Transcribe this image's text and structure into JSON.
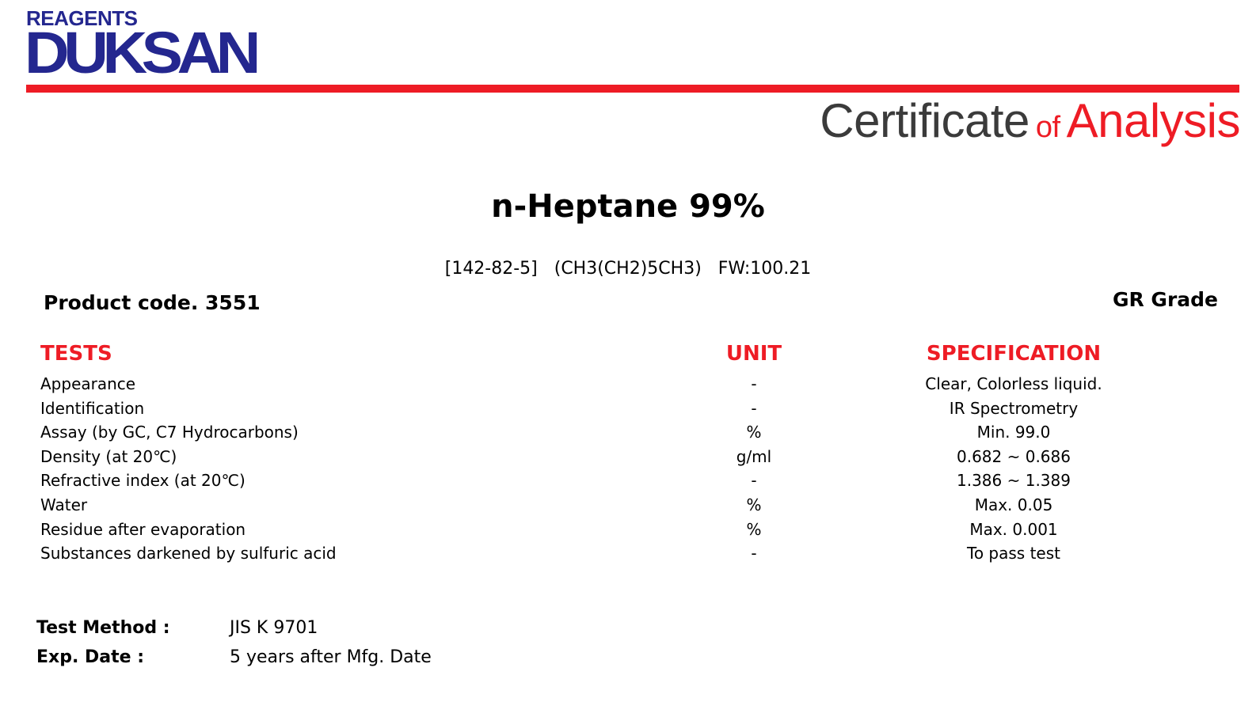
{
  "logo": {
    "top": "REAGENTS",
    "main": "DUKSAN"
  },
  "title": {
    "part1": "Certificate",
    "part2": "of",
    "part3": "Analysis"
  },
  "product": {
    "name": "n-Heptane 99%",
    "formula_line": "[142-82-5]   (CH3(CH2)5CH3)   FW:100.21",
    "code": "Product code. 3551",
    "grade": "GR Grade"
  },
  "table": {
    "headers": {
      "tests": "TESTS",
      "unit": "UNIT",
      "spec": "SPECIFICATION"
    },
    "rows": [
      {
        "test": "Appearance",
        "unit": "-",
        "spec": "Clear, Colorless liquid."
      },
      {
        "test": "Identification",
        "unit": "-",
        "spec": "IR Spectrometry"
      },
      {
        "test": "Assay (by GC, C7 Hydrocarbons)",
        "unit": "%",
        "spec": "Min. 99.0"
      },
      {
        "test": "Density (at 20℃)",
        "unit": "g/ml",
        "spec": "0.682 ~ 0.686"
      },
      {
        "test": "Refractive index (at 20℃)",
        "unit": "-",
        "spec": "1.386 ~ 1.389"
      },
      {
        "test": "Water",
        "unit": "%",
        "spec": "Max. 0.05"
      },
      {
        "test": "Residue after evaporation",
        "unit": "%",
        "spec": "Max. 0.001"
      },
      {
        "test": "Substances darkened by sulfuric acid",
        "unit": "-",
        "spec": "To pass test"
      }
    ]
  },
  "footer": {
    "method_label": "Test Method :",
    "method_value": "JIS K 9701",
    "exp_label": "Exp. Date :",
    "exp_value": "5 years after Mfg. Date"
  },
  "colors": {
    "brand_blue": "#24278f",
    "accent_red": "#ee1c25",
    "title_gray": "#3b3b3b"
  }
}
